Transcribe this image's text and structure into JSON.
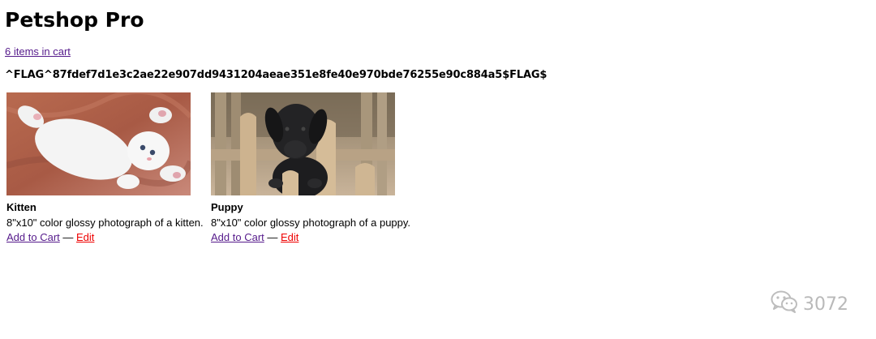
{
  "header": {
    "title": "Petshop Pro",
    "cart_link": "6 items in cart",
    "flag_text": "^FLAG^87fdef7d1e3c2ae22e907dd9431204aeae351e8fe40e970bde76255e90c884a5$FLAG$"
  },
  "products": [
    {
      "name": "Kitten",
      "description": "8\"x10\" color glossy photograph of a kitten.",
      "add_label": "Add to Cart",
      "separator": "—",
      "edit_label": "Edit"
    },
    {
      "name": "Puppy",
      "description": "8\"x10\" color glossy photograph of a puppy.",
      "add_label": "Add to Cart",
      "separator": "—",
      "edit_label": "Edit"
    }
  ],
  "watermark": {
    "text": "3072",
    "icon": "wechat-icon"
  },
  "colors": {
    "visited_link": "#551a8b",
    "edit_link": "#ee0000"
  }
}
